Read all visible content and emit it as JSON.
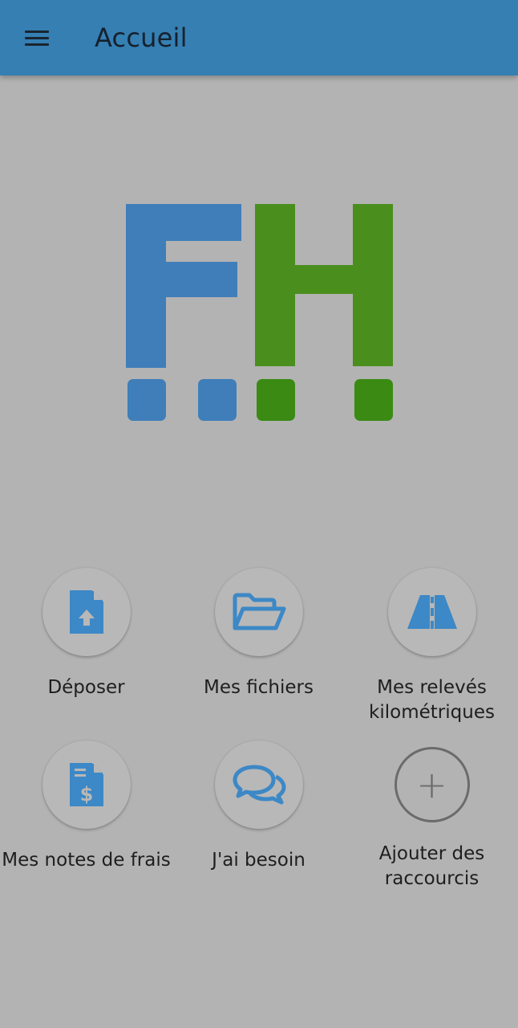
{
  "header": {
    "title": "Accueil",
    "menu_icon": "hamburger-menu-icon",
    "bg_color": "#357fb3"
  },
  "logo": {
    "letters": "FH",
    "blue": "#3f7eb9",
    "green": "#4a8f1e"
  },
  "shortcuts": [
    {
      "label": "Déposer",
      "icon": "file-upload-icon"
    },
    {
      "label": "Mes fichiers",
      "icon": "folder-open-icon"
    },
    {
      "label": "Mes relevés kilométriques",
      "icon": "road-icon"
    },
    {
      "label": "Mes notes de frais",
      "icon": "invoice-dollar-icon"
    },
    {
      "label": "J'ai besoin",
      "icon": "chat-bubbles-icon"
    },
    {
      "label": "Ajouter des raccourcis",
      "icon": "plus-icon"
    }
  ],
  "colors": {
    "icon_blue": "#3d88c6",
    "background": "#b3b3b3"
  }
}
